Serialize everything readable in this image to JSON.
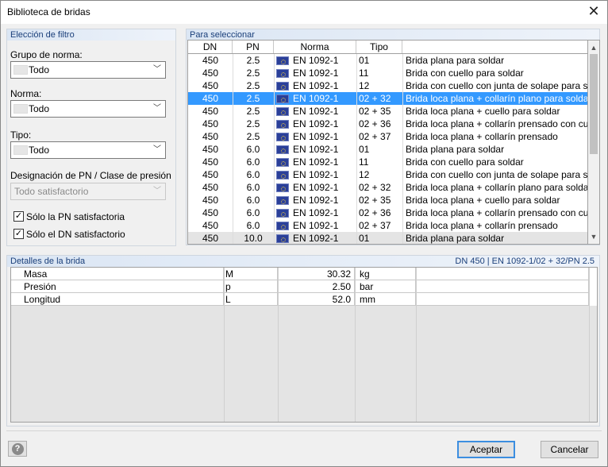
{
  "window": {
    "title": "Biblioteca de bridas",
    "close_glyph": "✕"
  },
  "filter": {
    "header": "Elección de filtro",
    "group_label": "Grupo de norma:",
    "group_value": "Todo",
    "norma_label": "Norma:",
    "norma_value": "Todo",
    "tipo_label": "Tipo:",
    "tipo_value": "Todo",
    "pn_label": "Designación de PN / Clase de presión",
    "pn_value": "Todo satisfactorio",
    "chk_pn_label": "Sólo la PN satisfactoria",
    "chk_pn_checked": true,
    "chk_dn_label": "Sólo el DN satisfactorio",
    "chk_dn_checked": true
  },
  "select": {
    "header": "Para seleccionar",
    "columns": [
      "DN",
      "PN",
      "Norma",
      "Tipo",
      ""
    ],
    "selected_index": 3,
    "rows": [
      {
        "dn": "450",
        "pn": "2.5",
        "norma": "EN 1092-1",
        "tipo": "01",
        "desc": "Brida plana para soldar"
      },
      {
        "dn": "450",
        "pn": "2.5",
        "norma": "EN 1092-1",
        "tipo": "11",
        "desc": "Brida con cuello para soldar"
      },
      {
        "dn": "450",
        "pn": "2.5",
        "norma": "EN 1092-1",
        "tipo": "12",
        "desc": "Brida con cuello con junta de solape para sold"
      },
      {
        "dn": "450",
        "pn": "2.5",
        "norma": "EN 1092-1",
        "tipo": "02 + 32",
        "desc": "Brida loca plana + collarín plano para soldar"
      },
      {
        "dn": "450",
        "pn": "2.5",
        "norma": "EN 1092-1",
        "tipo": "02 + 35",
        "desc": "Brida loca plana + cuello para soldar"
      },
      {
        "dn": "450",
        "pn": "2.5",
        "norma": "EN 1092-1",
        "tipo": "02 + 36",
        "desc": "Brida loca plana + collarín prensado con cuello"
      },
      {
        "dn": "450",
        "pn": "2.5",
        "norma": "EN 1092-1",
        "tipo": "02 + 37",
        "desc": "Brida loca plana + collarín prensado"
      },
      {
        "dn": "450",
        "pn": "6.0",
        "norma": "EN 1092-1",
        "tipo": "01",
        "desc": "Brida plana para soldar"
      },
      {
        "dn": "450",
        "pn": "6.0",
        "norma": "EN 1092-1",
        "tipo": "11",
        "desc": "Brida con cuello para soldar"
      },
      {
        "dn": "450",
        "pn": "6.0",
        "norma": "EN 1092-1",
        "tipo": "12",
        "desc": "Brida con cuello con junta de solape para sold"
      },
      {
        "dn": "450",
        "pn": "6.0",
        "norma": "EN 1092-1",
        "tipo": "02 + 32",
        "desc": "Brida loca plana + collarín plano para soldar"
      },
      {
        "dn": "450",
        "pn": "6.0",
        "norma": "EN 1092-1",
        "tipo": "02 + 35",
        "desc": "Brida loca plana + cuello para soldar"
      },
      {
        "dn": "450",
        "pn": "6.0",
        "norma": "EN 1092-1",
        "tipo": "02 + 36",
        "desc": "Brida loca plana + collarín prensado con cuello"
      },
      {
        "dn": "450",
        "pn": "6.0",
        "norma": "EN 1092-1",
        "tipo": "02 + 37",
        "desc": "Brida loca plana + collarín prensado"
      },
      {
        "dn": "450",
        "pn": "10.0",
        "norma": "EN 1092-1",
        "tipo": "01",
        "desc": "Brida plana para soldar"
      }
    ]
  },
  "details": {
    "header": "Detalles de la brida",
    "summary": "DN 450 | EN 1092-1/02 + 32/PN 2.5",
    "rows": [
      {
        "name": "Masa",
        "symbol": "M",
        "value": "30.32",
        "unit": "kg"
      },
      {
        "name": "Presión",
        "symbol": "p",
        "value": "2.50",
        "unit": "bar"
      },
      {
        "name": "Longitud",
        "symbol": "L",
        "value": "52.0",
        "unit": "mm"
      }
    ]
  },
  "buttons": {
    "accept": "Aceptar",
    "cancel": "Cancelar",
    "help": "?"
  },
  "colors": {
    "selection": "#3399ff",
    "group_header_text": "#1a3f7a",
    "default_button_border": "#3c8ee0"
  }
}
